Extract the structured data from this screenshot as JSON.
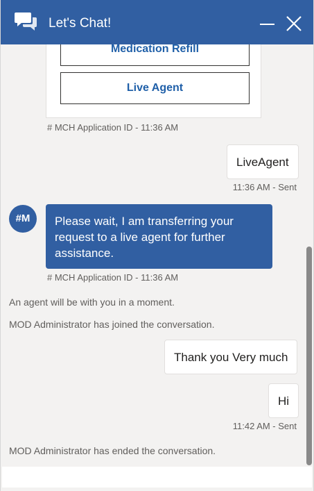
{
  "header": {
    "title": "Let's Chat!",
    "chat_icon": "chat-bubbles-icon",
    "minimize_icon": "minimize-icon",
    "close_icon": "close-icon",
    "bg_color": "#315fa2"
  },
  "options": {
    "medication_refill": "Medication Refill",
    "live_agent": "Live Agent"
  },
  "messages": {
    "bot_meta_1": "# MCH Application ID - 11:36 AM",
    "user_msg_1": "LiveAgent",
    "user_meta_1": "11:36 AM - Sent",
    "avatar_initials": "#M",
    "bot_msg_2": "Please wait, I am transferring your request to a live agent for further assistance.",
    "bot_meta_2": "# MCH Application ID - 11:36 AM",
    "system_1": "An agent will be with you in a moment.",
    "system_2": "MOD Administrator has joined the conversation.",
    "user_msg_2": "Thank you Very much",
    "user_msg_3": "Hi",
    "user_meta_3": "11:42 AM - Sent",
    "system_3": "MOD Administrator has ended the conversation."
  },
  "colors": {
    "accent": "#315fa2",
    "option_text": "#1f5fa8",
    "background": "#f3f2f1"
  }
}
